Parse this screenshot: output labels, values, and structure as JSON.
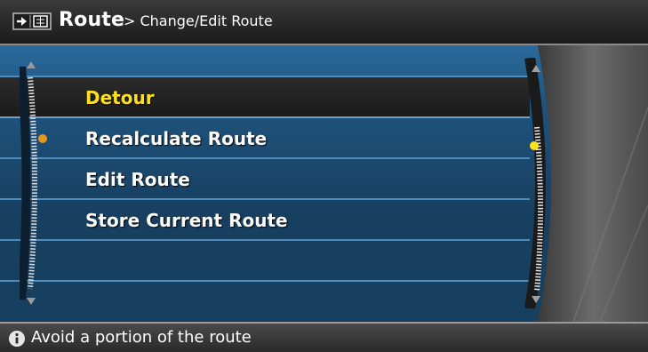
{
  "header": {
    "icon": "route-menu-icon",
    "title": "Route",
    "breadcrumb": "> Change/Edit Route"
  },
  "menu": {
    "items": [
      {
        "label": "Detour",
        "selected": true
      },
      {
        "label": "Recalculate Route",
        "selected": false
      },
      {
        "label": "Edit Route",
        "selected": false
      },
      {
        "label": "Store Current Route",
        "selected": false
      }
    ]
  },
  "status": {
    "icon": "info-icon",
    "text": "Avoid a portion of the route"
  },
  "colors": {
    "selected_text": "#ffe01b",
    "indicator_orange": "#e8951c",
    "list_blue": "#1f557f"
  }
}
